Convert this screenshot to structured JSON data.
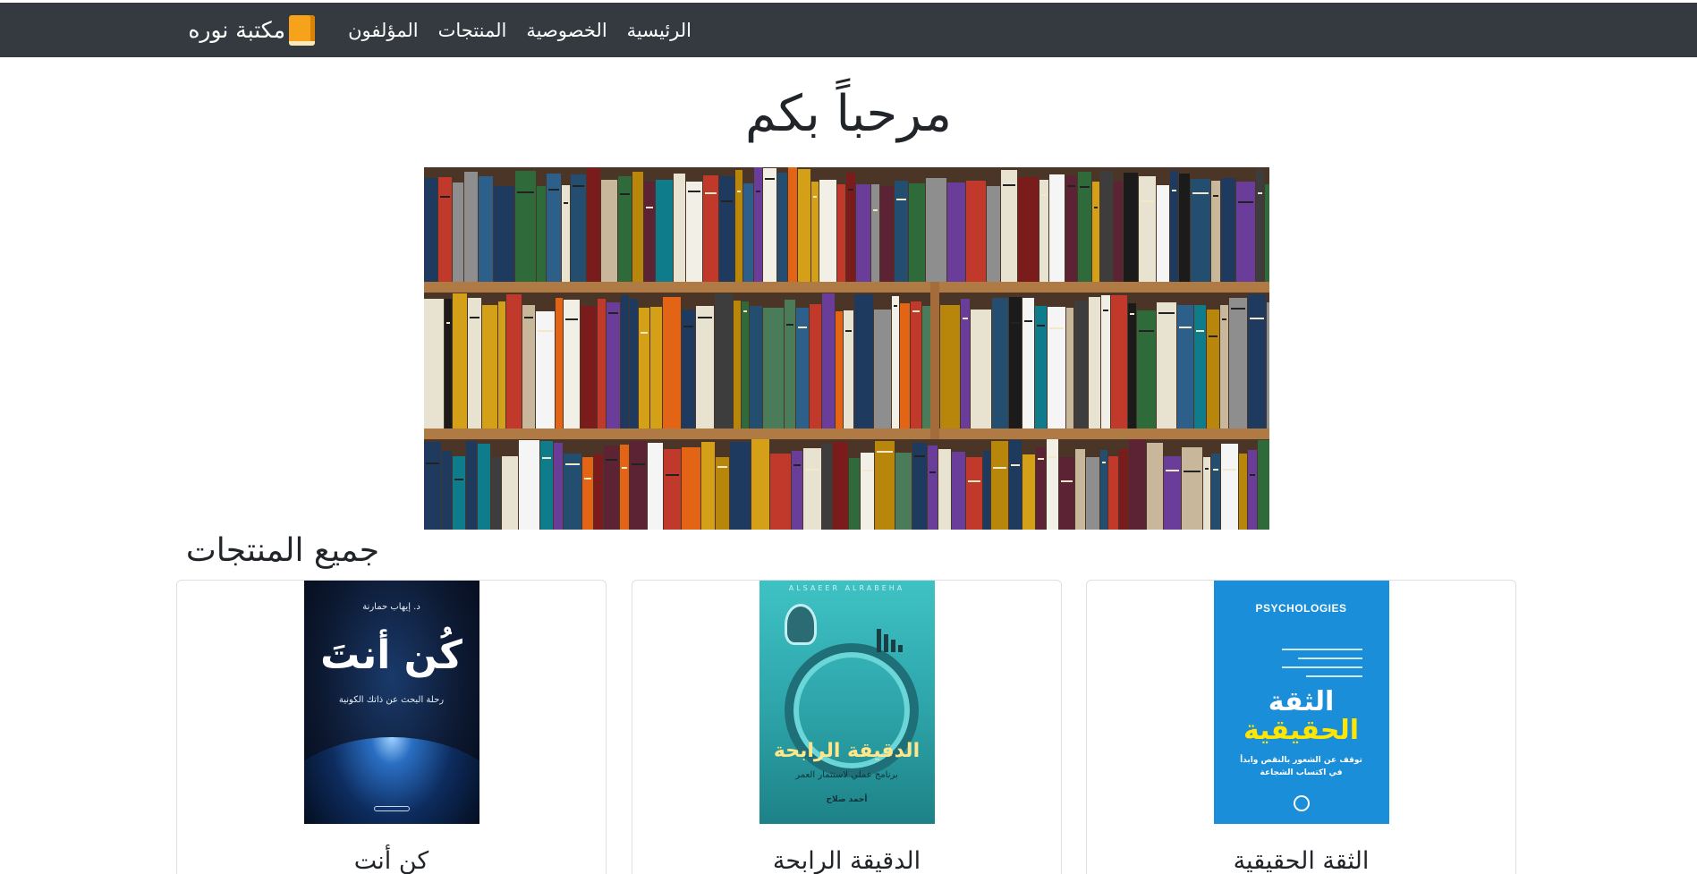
{
  "navbar": {
    "brand": "مكتبة نوره",
    "brand_icon": "book-icon",
    "links": [
      "الرئيسية",
      "الخصوصية",
      "المنتجات",
      "المؤلفون"
    ]
  },
  "hero": {
    "title": "مرحباً بكم",
    "image": "bookshelf-photo"
  },
  "products": {
    "heading": "جميع المنتجات",
    "cards": [
      {
        "title": "الثقة الحقيقية",
        "cover": {
          "publisher_top": "PSYCHOLOGIES",
          "title_line1": "الثقة",
          "title_line2": "الحقيقية",
          "subtitle": "توقف عن الشعور بالنقص وابدأ في اكتساب الشجاعة"
        }
      },
      {
        "title": "الدقيقة الرابحة",
        "cover": {
          "top": "ALSAEER ALRABEHA",
          "title": "الدقيقة الرابحة",
          "subtitle": "برنامج عملي لاستثمار العمر",
          "author": "أحمد صلاح"
        }
      },
      {
        "title": "كن أنت",
        "cover": {
          "author": "د. إيهاب حمارنة",
          "title": "كُن أنتَ",
          "subtitle": "رحلة البحث عن ذاتك الكونية"
        }
      }
    ]
  },
  "colors": {
    "navbar_bg": "#343a40",
    "brand_icon": "#f6a21a"
  }
}
